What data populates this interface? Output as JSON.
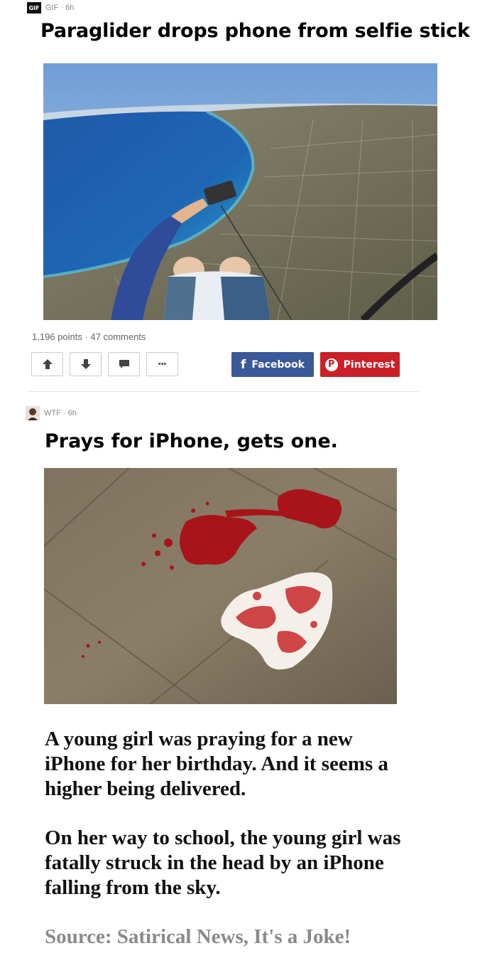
{
  "post1": {
    "badge": "GIF",
    "meta": "GIF · 6h",
    "title": "Paraglider drops phone from selfie stick",
    "stats": "1,196 points · 47 comments",
    "buttons": {
      "upvote_icon": "arrow-up-icon",
      "downvote_icon": "arrow-down-icon",
      "comment_icon": "comment-icon",
      "more_label": "•••"
    },
    "share": {
      "facebook_label": "Facebook",
      "pinterest_label": "Pinterest",
      "facebook_color": "#3b5998",
      "pinterest_color": "#cb2027"
    }
  },
  "post2": {
    "meta": "WTF · 6h",
    "title": "Prays for iPhone, gets one.",
    "paragraph1": "A young girl was praying for a new iPhone for her birthday. And it seems a higher being delivered.",
    "paragraph2": "On her way to school, the young girl was fatally struck in the head by an iPhone falling from the sky.",
    "source": "Source: Satirical News, It's a Joke!"
  }
}
